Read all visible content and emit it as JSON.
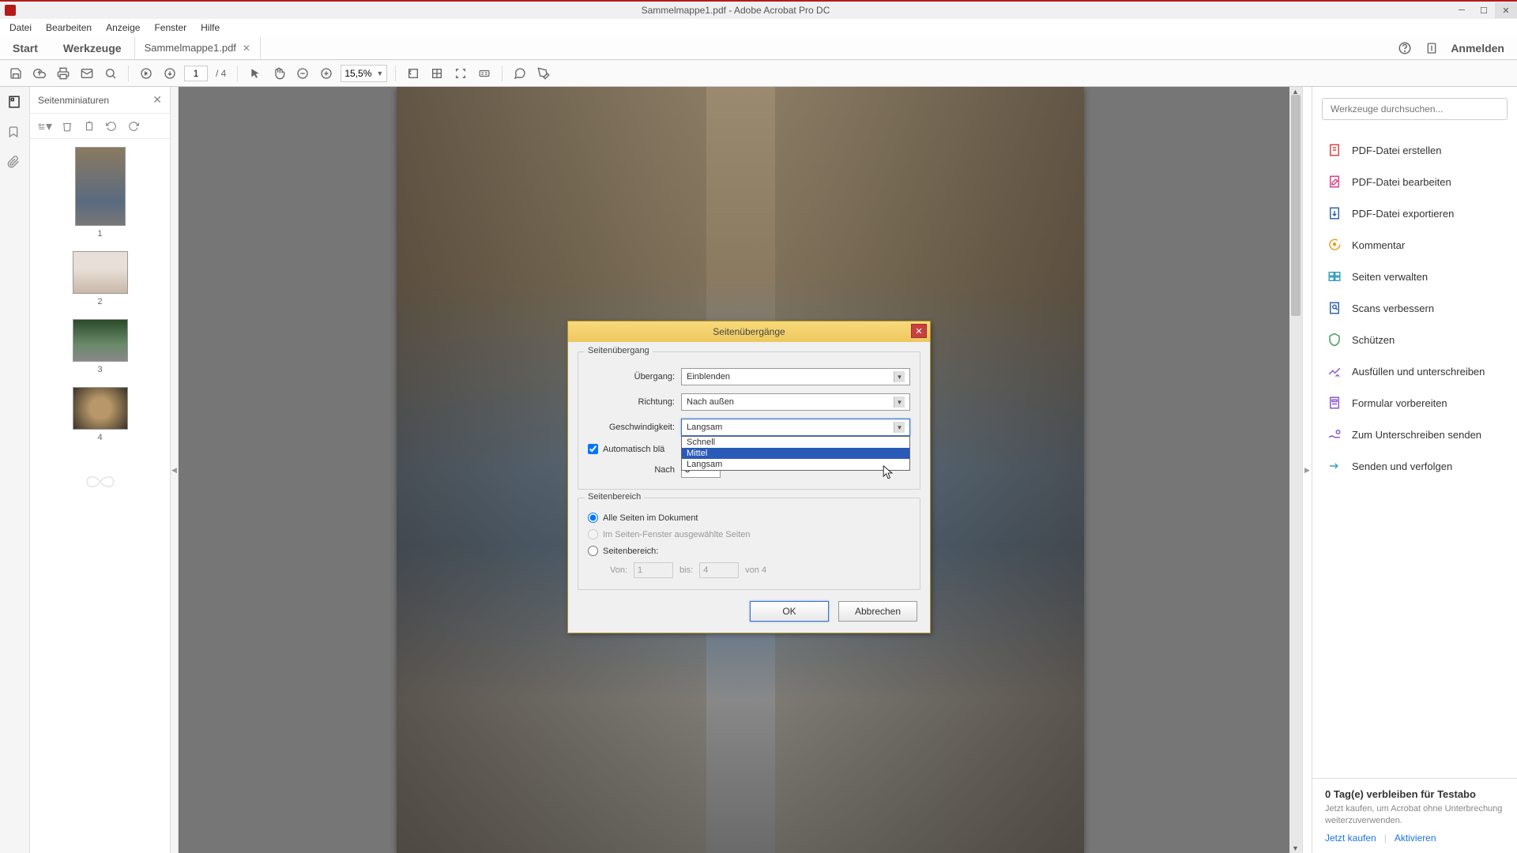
{
  "titlebar": {
    "title": "Sammelmappe1.pdf - Adobe Acrobat Pro DC"
  },
  "menubar": {
    "items": [
      "Datei",
      "Bearbeiten",
      "Anzeige",
      "Fenster",
      "Hilfe"
    ]
  },
  "tabbar": {
    "start": "Start",
    "tools": "Werkzeuge",
    "doc_tab": "Sammelmappe1.pdf",
    "login": "Anmelden"
  },
  "toolbar": {
    "page_current": "1",
    "page_total": "/ 4",
    "zoom": "15,5%"
  },
  "thumb_panel": {
    "title": "Seitenminiaturen",
    "pages": [
      "1",
      "2",
      "3",
      "4"
    ]
  },
  "right_panel": {
    "search_placeholder": "Werkzeuge durchsuchen...",
    "tools": [
      {
        "label": "PDF-Datei erstellen",
        "color": "#d44"
      },
      {
        "label": "PDF-Datei bearbeiten",
        "color": "#d48"
      },
      {
        "label": "PDF-Datei exportieren",
        "color": "#36a"
      },
      {
        "label": "Kommentar",
        "color": "#e8a020"
      },
      {
        "label": "Seiten verwalten",
        "color": "#3aa0c0"
      },
      {
        "label": "Scans verbessern",
        "color": "#36a"
      },
      {
        "label": "Schützen",
        "color": "#4aa060"
      },
      {
        "label": "Ausfüllen und unterschreiben",
        "color": "#8a5ad0"
      },
      {
        "label": "Formular vorbereiten",
        "color": "#8a5ad0"
      },
      {
        "label": "Zum Unterschreiben senden",
        "color": "#8a5ad0"
      },
      {
        "label": "Senden und verfolgen",
        "color": "#3aa0c0"
      }
    ],
    "promo": {
      "title": "0 Tag(e) verbleiben für Testabo",
      "text": "Jetzt kaufen, um Acrobat ohne Unterbrechung weiterzuverwenden.",
      "buy": "Jetzt kaufen",
      "activate": "Aktivieren"
    }
  },
  "dialog": {
    "title": "Seitenübergänge",
    "group1_title": "Seitenübergang",
    "transition_label": "Übergang:",
    "transition_value": "Einblenden",
    "direction_label": "Richtung:",
    "direction_value": "Nach außen",
    "speed_label": "Geschwindigkeit:",
    "speed_value": "Langsam",
    "speed_options": [
      "Schnell",
      "Mittel",
      "Langsam"
    ],
    "auto_flip_label": "Automatisch blä",
    "after_label": "Nach",
    "after_value": "3",
    "group2_title": "Seitenbereich",
    "radio_all": "Alle Seiten im Dokument",
    "radio_selected": "Im Seiten-Fenster ausgewählte Seiten",
    "radio_range": "Seitenbereich:",
    "from_label": "Von:",
    "from_value": "1",
    "to_label": "bis:",
    "to_value": "4",
    "of_label": "von 4",
    "ok": "OK",
    "cancel": "Abbrechen"
  }
}
